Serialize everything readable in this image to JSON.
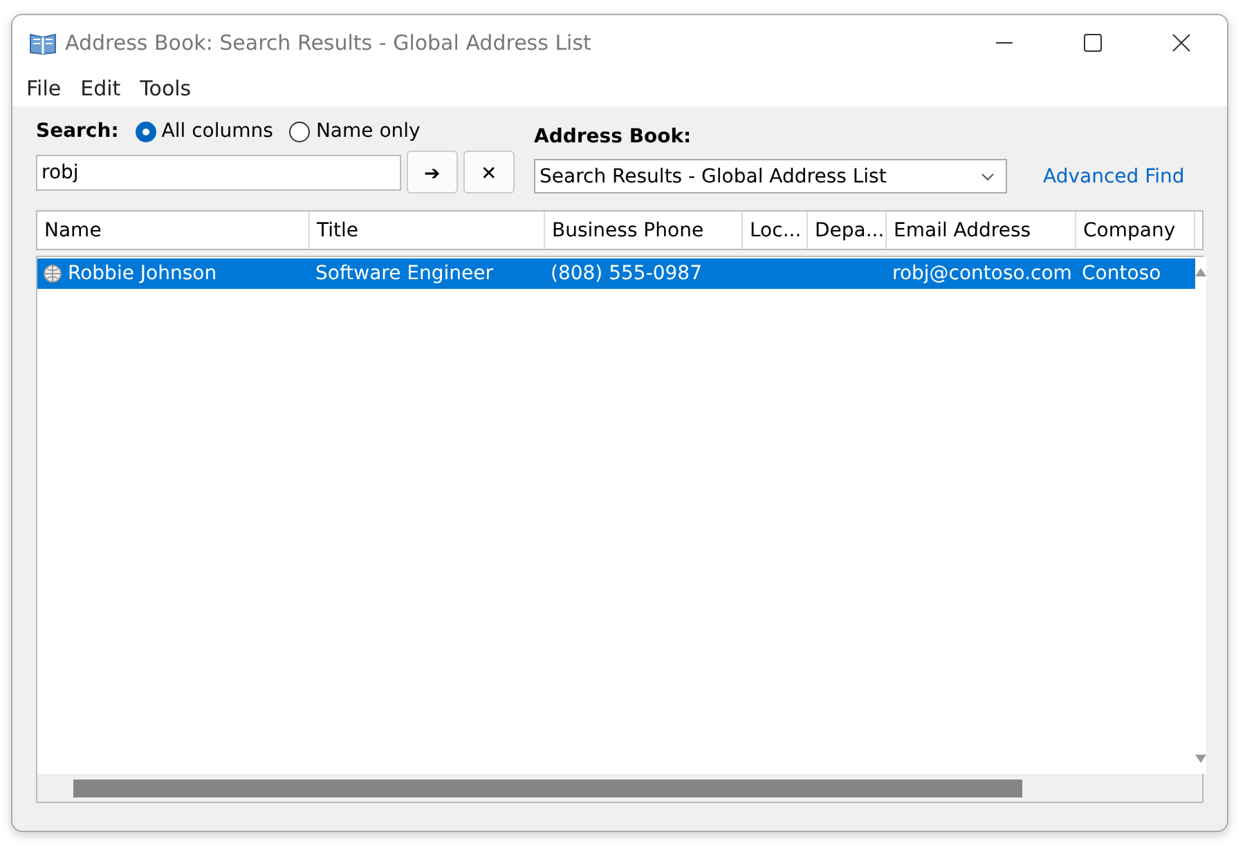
{
  "window": {
    "title": "Address Book: Search Results - Global Address List"
  },
  "menu": [
    "File",
    "Edit",
    "Tools"
  ],
  "search": {
    "label": "Search:",
    "value": "robj",
    "options": [
      {
        "label": "All columns",
        "selected": true
      },
      {
        "label": "Name only",
        "selected": false
      }
    ],
    "go_button": "➔",
    "clear_button": "✕"
  },
  "address_book": {
    "label": "Address Book:",
    "value": "Search Results - Global Address List",
    "advanced_link": "Advanced Find"
  },
  "table": {
    "columns": [
      "Name",
      "Title",
      "Business Phone",
      "Loc...",
      "Depa...",
      "Email Address",
      "Company"
    ],
    "rows": [
      {
        "selected": true,
        "cells": [
          "Robbie Johnson",
          "Software Engineer",
          "(808) 555-0987",
          "",
          "",
          "robj@contoso.com",
          "Contoso"
        ]
      }
    ]
  }
}
